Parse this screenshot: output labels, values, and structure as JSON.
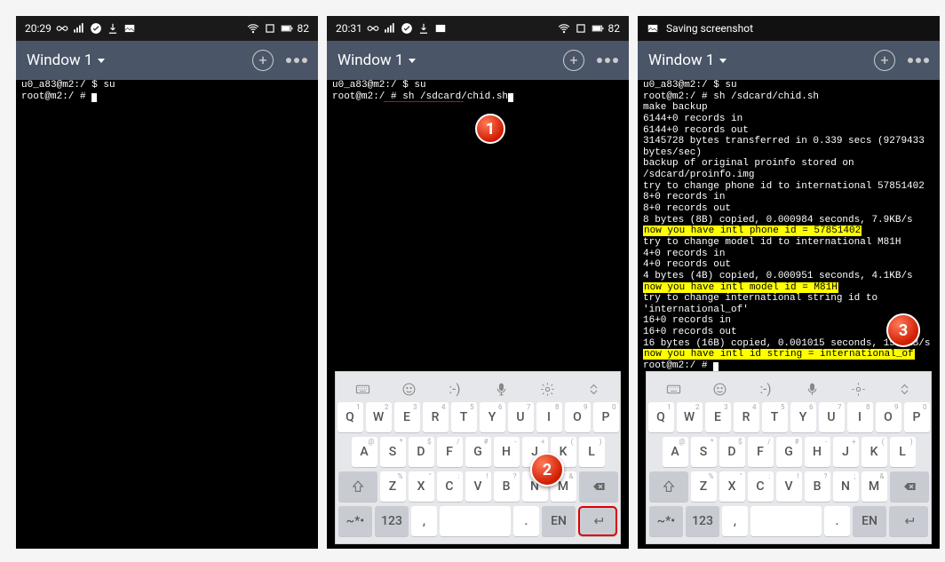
{
  "status": {
    "time1": "20:29",
    "time2": "20:31",
    "battery": "82",
    "saving": "Saving screenshot"
  },
  "window": {
    "title": "Window 1"
  },
  "term": {
    "prompt_user": "u0_a83@m2:/ $ su",
    "prompt_root": "root@m2:/ # ",
    "cmd": "sh /sdcard/chid.sh",
    "lines": [
      "make backup",
      "6144+0 records in",
      "6144+0 records out",
      "3145728 bytes transferred in 0.339 secs (9279433 bytes/sec)",
      "backup of original proinfo stored on /sdcard/proinfo.img",
      "try to change phone id to international 57851402",
      "8+0 records in",
      "8+0 records out",
      "8 bytes (8B) copied, 0.000984 seconds, 7.9KB/s"
    ],
    "hl1": "now you have intl phone id = 57851402",
    "mid1": [
      "try to change model id to international M81H",
      "4+0 records in",
      "4+0 records out",
      "4 bytes (4B) copied, 0.000951 seconds, 4.1KB/s"
    ],
    "hl2": "now you have intl model id = M81H",
    "mid2": [
      "try to change international string id to 'international_of'",
      "16+0 records in",
      "16+0 records out",
      "16 bytes (16B) copied, 0.001015 seconds, 15.4KB/s"
    ],
    "hl3": "now you have intl id string = international_of",
    "final_prompt": "root@m2:/ # "
  },
  "keys": {
    "r1": [
      "Q",
      "W",
      "E",
      "R",
      "T",
      "Y",
      "U",
      "I",
      "O",
      "P"
    ],
    "r1sub": [
      "",
      "1",
      "2",
      "3",
      "4",
      "5",
      "6",
      "7",
      "8",
      "9",
      "0"
    ],
    "r2": [
      "A",
      "S",
      "D",
      "F",
      "G",
      "H",
      "J",
      "K",
      "L"
    ],
    "r2sub": [
      "@",
      "*",
      "$",
      "/",
      "#",
      "-",
      "+",
      "(",
      ")"
    ],
    "r3": [
      "Z",
      "X",
      "C",
      "V",
      "B",
      "N",
      "M"
    ],
    "r3sub": [
      "%",
      "\"",
      ":",
      "!",
      "?",
      ";",
      "&"
    ],
    "sym": "~*•",
    "num": "123",
    "comma": ",",
    "dot": ".",
    "en": "EN"
  }
}
